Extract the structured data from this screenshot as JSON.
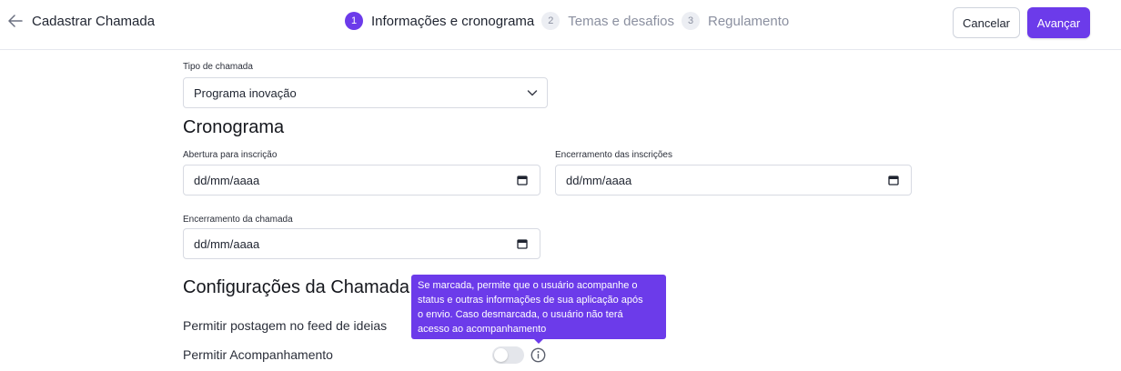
{
  "header": {
    "title": "Cadastrar Chamada",
    "steps": [
      {
        "number": "1",
        "label": "Informações e cronograma",
        "state": "active"
      },
      {
        "number": "2",
        "label": "Temas e desafios",
        "state": "inactive"
      },
      {
        "number": "3",
        "label": "Regulamento",
        "state": "inactive"
      }
    ],
    "cancel_label": "Cancelar",
    "next_label": "Avançar"
  },
  "form": {
    "call_type": {
      "label": "Tipo de chamada",
      "value": "Programa inovação"
    },
    "schedule": {
      "title": "Cronograma",
      "registration_open": {
        "label": "Abertura para inscrição",
        "value": "dd/mm/aaaa"
      },
      "registration_close": {
        "label": "Encerramento das inscrições",
        "value": "dd/mm/aaaa"
      },
      "call_close": {
        "label": "Encerramento da chamada",
        "value": "dd/mm/aaaa"
      }
    },
    "settings": {
      "title": "Configurações da Chamada",
      "allow_feed_post": {
        "label": "Permitir postagem no feed de ideias"
      },
      "allow_tracking": {
        "label": "Permitir Acompanhamento",
        "enabled": false
      }
    }
  },
  "tooltip": {
    "lines": [
      "Se marcada, permite que o usuário acompanhe o",
      "status e outras informações de sua aplicação após",
      "o envio. Caso desmarcada, o usuário não terá",
      "acesso ao acompanhamento"
    ]
  },
  "icons": {
    "back": "arrow-left-icon",
    "select": "chevron-down-icon",
    "date": "calendar-icon",
    "info": "info-icon"
  },
  "colors": {
    "accent": "#6c3bea",
    "step_inactive_bg": "#eceef3",
    "step_inactive_text": "#8b90a0",
    "toggle_off": "#e4e6eb"
  }
}
